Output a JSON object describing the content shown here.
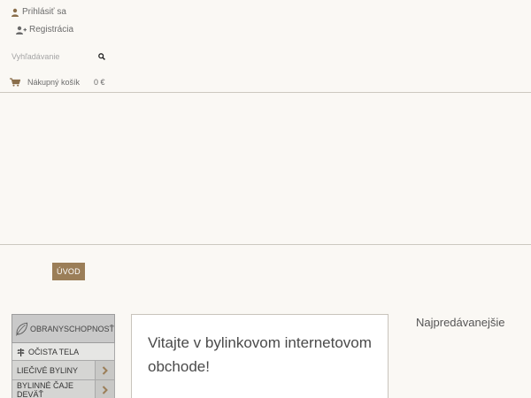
{
  "header": {
    "login_label": "Prihlásiť sa",
    "register_label": "Registrácia",
    "search_placeholder": "Vyhľadávanie",
    "cart_label": "Nákupný košík",
    "cart_total": "0 €"
  },
  "nav": {
    "home_label": "ÚVOD"
  },
  "sidebar": {
    "main_category": "OBRANYSCHOPNOSŤ",
    "sub_category": "OČISTA TELA",
    "items": [
      {
        "label": "LIEČIVÉ BYLINY"
      },
      {
        "label": "BYLINNÉ ČAJE DEVÄŤ"
      }
    ]
  },
  "main": {
    "welcome_title": "Vitajte v bylinkovom internetovom obchode!"
  },
  "right": {
    "bestsellers_title": "Najpredávanejšie"
  },
  "colors": {
    "accent": "#9b7e58",
    "background": "#faf8f4",
    "sidebar_gray": "#c9c9c9",
    "arrow": "#9b7e58"
  }
}
